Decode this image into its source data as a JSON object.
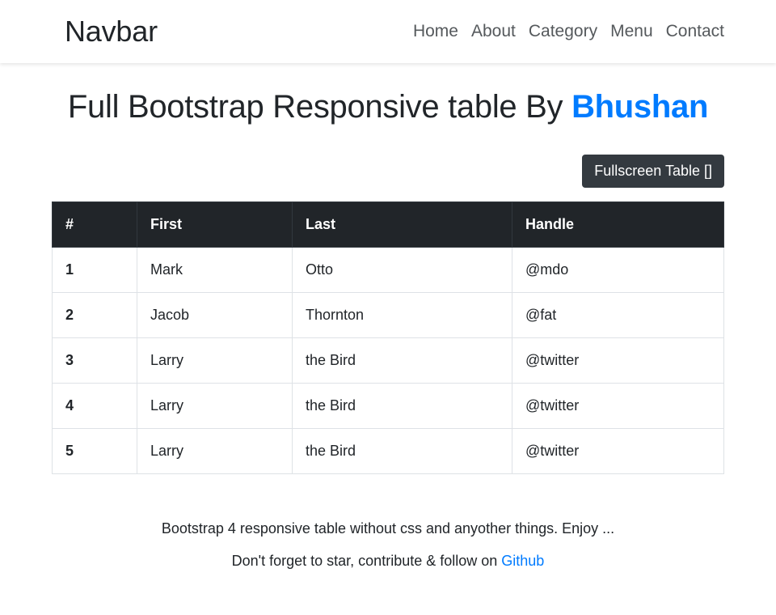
{
  "navbar": {
    "brand": "Navbar",
    "links": [
      {
        "label": "Home"
      },
      {
        "label": "About"
      },
      {
        "label": "Category"
      },
      {
        "label": "Menu"
      },
      {
        "label": "Contact"
      }
    ]
  },
  "heading": {
    "text": "Full Bootstrap Responsive table By",
    "accent": "Bhushan",
    "accent_color": "#007bff"
  },
  "toolbar": {
    "fullscreen_label": "Fullscreen Table []",
    "button_color": "#343a40"
  },
  "table": {
    "columns": [
      "#",
      "First",
      "Last",
      "Handle"
    ],
    "header_bg": "#212529",
    "rows": [
      {
        "num": "1",
        "first": "Mark",
        "last": "Otto",
        "handle": "@mdo"
      },
      {
        "num": "2",
        "first": "Jacob",
        "last": "Thornton",
        "handle": "@fat"
      },
      {
        "num": "3",
        "first": "Larry",
        "last": "the Bird",
        "handle": "@twitter"
      },
      {
        "num": "4",
        "first": "Larry",
        "last": "the Bird",
        "handle": "@twitter"
      },
      {
        "num": "5",
        "first": "Larry",
        "last": "the Bird",
        "handle": "@twitter"
      }
    ]
  },
  "footer": {
    "line1": "Bootstrap 4 responsive table without css and anyother things. Enjoy ...",
    "line2_prefix": "Don't forget to star, contribute & follow on ",
    "link_label": "Github",
    "link_color": "#007bff"
  }
}
